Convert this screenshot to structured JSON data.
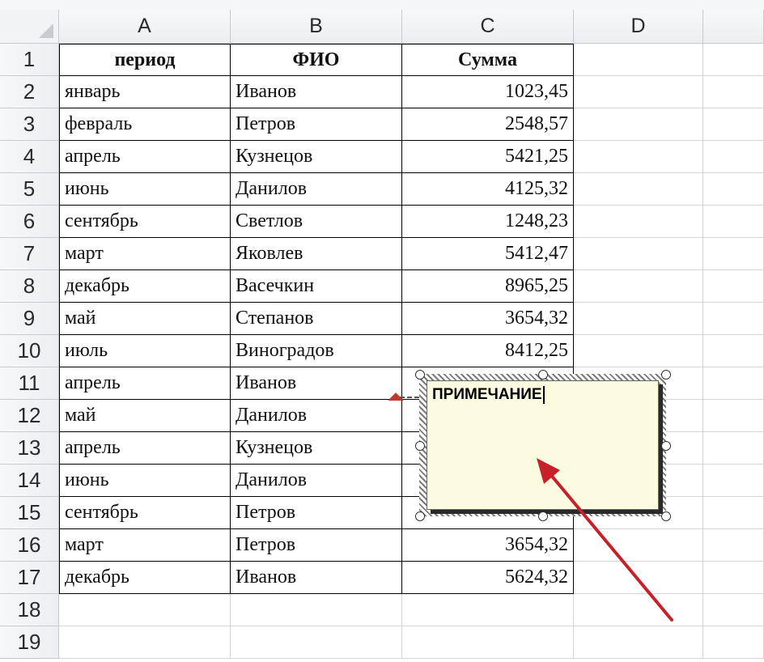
{
  "columns": [
    "A",
    "B",
    "C",
    "D",
    ""
  ],
  "header_row": {
    "period": "период",
    "fio": "ФИО",
    "sum": "Сумма"
  },
  "rows": [
    {
      "num": "1"
    },
    {
      "num": "2",
      "period": "январь",
      "fio": "Иванов",
      "sum": "1023,45"
    },
    {
      "num": "3",
      "period": "февраль",
      "fio": "Петров",
      "sum": "2548,57"
    },
    {
      "num": "4",
      "period": "апрель",
      "fio": "Кузнецов",
      "sum": "5421,25"
    },
    {
      "num": "5",
      "period": "июнь",
      "fio": "Данилов",
      "sum": "4125,32"
    },
    {
      "num": "6",
      "period": "сентябрь",
      "fio": "Светлов",
      "sum": "1248,23"
    },
    {
      "num": "7",
      "period": "март",
      "fio": "Яковлев",
      "sum": "5412,47"
    },
    {
      "num": "8",
      "period": "декабрь",
      "fio": "Васечкин",
      "sum": "8965,25"
    },
    {
      "num": "9",
      "period": "май",
      "fio": "Степанов",
      "sum": "3654,32"
    },
    {
      "num": "10",
      "period": "июль",
      "fio": "Виноградов",
      "sum": "8412,25"
    },
    {
      "num": "11",
      "period": "апрель",
      "fio": "Иванов",
      "sum": ""
    },
    {
      "num": "12",
      "period": "май",
      "fio": "Данилов",
      "sum": ""
    },
    {
      "num": "13",
      "period": "апрель",
      "fio": "Кузнецов",
      "sum": ""
    },
    {
      "num": "14",
      "period": "июнь",
      "fio": "Данилов",
      "sum": ""
    },
    {
      "num": "15",
      "period": "сентябрь",
      "fio": "Петров",
      "sum": ""
    },
    {
      "num": "16",
      "period": "март",
      "fio": "Петров",
      "sum": "3654,32"
    },
    {
      "num": "17",
      "period": "декабрь",
      "fio": "Иванов",
      "sum": "5624,32"
    },
    {
      "num": "18"
    },
    {
      "num": "19"
    }
  ],
  "comment": {
    "text": "ПРИМЕЧАНИЕ"
  },
  "colors": {
    "annotation_arrow": "#c8202b",
    "comment_fill": "#fbfbe0",
    "comment_indicator": "#c0392b"
  },
  "icons": [
    "select-all-icon",
    "comment-indicator-icon",
    "annotation-arrow-icon"
  ]
}
